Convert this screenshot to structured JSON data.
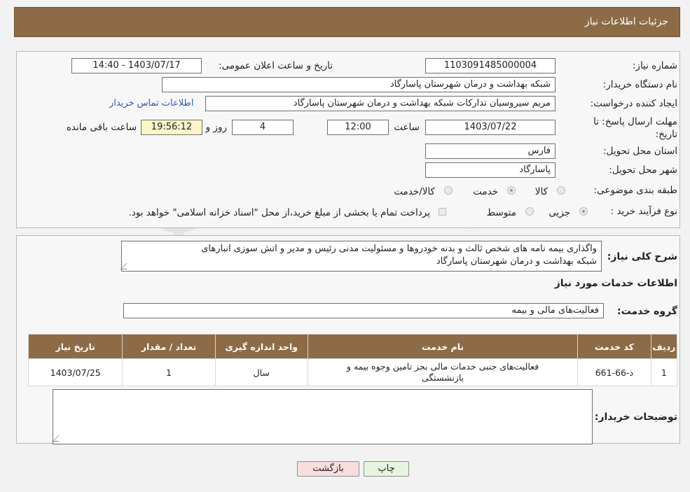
{
  "header": {
    "title": "جزئیات اطلاعات نیاز"
  },
  "form": {
    "need_number_label": "شماره نیاز:",
    "need_number": "1103091485000004",
    "announce_label": "تاریخ و ساعت اعلان عمومی:",
    "announce_value": "1403/07/17 - 14:40",
    "buyer_org_label": "نام دستگاه خریدار:",
    "buyer_org": "شبکه بهداشت و درمان شهرستان پاسارگاد",
    "creator_label": "ایجاد کننده درخواست:",
    "creator": "مریم سیروسیان تداركات شبکه بهداشت و درمان شهرستان پاسارگاد",
    "contact_link": "اطلاعات تماس خریدار",
    "deadline_label_1": "مهلت ارسال پاسخ: تا",
    "deadline_label_2": "تاریخ:",
    "deadline_date": "1403/07/22",
    "time_label": "ساعت",
    "deadline_time": "12:00",
    "days_value": "4",
    "days_label": "روز و",
    "remaining_time": "19:56:12",
    "remaining_label": "ساعت باقی مانده",
    "province_label": "استان محل تحویل:",
    "province": "فارس",
    "city_label": "شهر محل تحویل:",
    "city": "پاسارگاد",
    "category_label": "طبقه بندی موضوعی:",
    "category_options": [
      "کالا",
      "خدمت",
      "کالا/خدمت"
    ],
    "process_label": "نوع فرآیند خرید :",
    "process_options": [
      "جزیی",
      "متوسط"
    ],
    "payment_note": "پرداخت تمام یا بخشی از مبلغ خرید،از محل \"اسناد خزانه اسلامی\" خواهد بود."
  },
  "summary": {
    "label": "شرح کلی نیاز:",
    "text_line1": "واگذاری بیمه نامه های شخص ثالث و بدنه خودروها و مسئولیت مدنی رئیس و مدیر و اتش سوزی انبارهای",
    "text_line2": "شبکه بهداشت و درمان شهرستان پاسارگاد",
    "services_heading": "اطلاعات خدمات مورد نیاز",
    "group_label": "گروه خدمت:",
    "group_value": "فعالیت‌های مالی و بیمه"
  },
  "table": {
    "headers": [
      "ردیف",
      "کد خدمت",
      "نام خدمت",
      "واحد اندازه گیری",
      "تعداد / مقدار",
      "تاریخ نیاز"
    ],
    "row": {
      "index": "1",
      "code": "ذ-66-661",
      "name_line1": "فعالیت‌های جنبی خدمات مالی بجز تامین وجوه بیمه و",
      "name_line2": "بازنشستگی",
      "unit": "سال",
      "qty": "1",
      "date": "1403/07/25"
    }
  },
  "notes": {
    "label": "توضیحات خریدار:"
  },
  "buttons": {
    "print": "چاپ",
    "back": "بازگشت"
  },
  "watermark": "AriaTender.neT"
}
